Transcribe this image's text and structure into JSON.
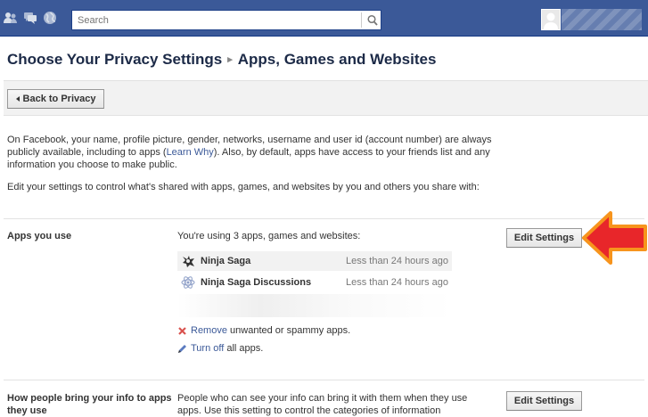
{
  "topbar": {
    "jewels": [
      "friend-requests-icon",
      "messages-icon",
      "notifications-icon"
    ],
    "search_placeholder": "Search",
    "brand_color": "#3b5998"
  },
  "heading": {
    "main": "Choose Your Privacy Settings",
    "separator": "▸",
    "sub": "Apps, Games and Websites"
  },
  "back_button": "Back to Privacy",
  "intro": {
    "p1_before": "On Facebook, your name, profile picture, gender, networks, username and user id (account number) are always publicly available, including to apps (",
    "p1_link": "Learn Why",
    "p1_after": "). Also, by default, apps have access to your friends list and any information you choose to make public.",
    "p2": "Edit your settings to control what's shared with apps, games, and websites by you and others you share with:"
  },
  "apps_section": {
    "label": "Apps you use",
    "summary": "You're using 3 apps, games and websites:",
    "edit_label": "Edit Settings",
    "apps": [
      {
        "name": "Ninja Saga",
        "time": "Less than 24 hours ago",
        "icon": "ninja-icon"
      },
      {
        "name": "Ninja Saga Discussions",
        "time": "Less than 24 hours ago",
        "icon": "discussion-icon"
      }
    ],
    "remove_link": "Remove",
    "remove_rest": "unwanted or spammy apps.",
    "turnoff_link": "Turn off",
    "turnoff_rest": "all apps."
  },
  "bring_section": {
    "label": "How people bring your info to apps they use",
    "desc": "People who can see your info can bring it with them when they use apps. Use this setting to control the categories of information",
    "edit_label": "Edit Settings"
  },
  "annotation": {
    "arrow_color": "#e8262a",
    "arrow_border": "#f7941d"
  }
}
